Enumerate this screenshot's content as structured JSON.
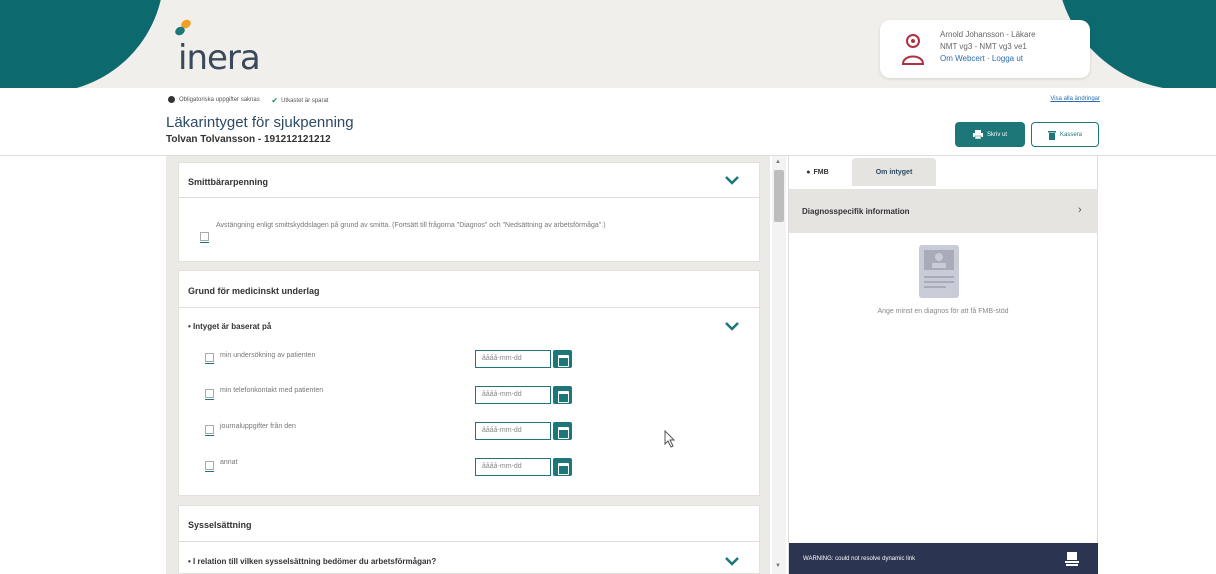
{
  "header": {
    "logo_text": "inera",
    "user_line1": "Arnold Johansson - Läkare",
    "user_line2": "NMT vg3 - NMT vg3 ve1",
    "user_link_about": "Om Webcert",
    "user_link_logout": "Logga ut"
  },
  "status": {
    "unsigned": "Obligatoriska uppgifter saknas",
    "saved": "Utkastet är sparat",
    "right_link": "Visa alla ändringar"
  },
  "page": {
    "title": "Läkarintyget för sjukpenning",
    "patient": "Tolvan Tolvansson - 191212121212"
  },
  "actions": {
    "print": "Skriv ut",
    "discard": "Kassera"
  },
  "sections": {
    "smitt": {
      "title": "Smittbärarpenning",
      "text": "Avstängning enligt smittskyddslagen på grund av smitta. (Fortsätt till frågorna \"Diagnos\" och \"Nedsättning av arbetsförmåga\".)"
    },
    "grund": {
      "title": "Grund för medicinskt underlag",
      "question": "Intyget är baserat på",
      "rows": [
        {
          "label": "min undersökning av patienten",
          "placeholder": "åååå-mm-dd"
        },
        {
          "label": "min telefonkontakt med patienten",
          "placeholder": "åååå-mm-dd"
        },
        {
          "label": "journaluppgifter från den",
          "placeholder": "åååå-mm-dd"
        },
        {
          "label": "annat",
          "placeholder": "åååå-mm-dd"
        }
      ]
    },
    "syssel": {
      "title": "Sysselsättning",
      "question": "I relation till vilken sysselsättning bedömer du arbetsförmågan?"
    }
  },
  "sidebar": {
    "tab_fmb": "FMB",
    "tab_om": "Om intyget",
    "diag_label": "Diagnosspecifik information",
    "fmb_note": "Ange minst en diagnos för att få FMB-stöd",
    "warning": "WARNING: could not resolve dynamic link"
  },
  "colors": {
    "accent": "#1d7779",
    "brand_dark": "#0c6a6f",
    "header_bg": "#f1efeb",
    "warning_bg": "#2b3450"
  }
}
